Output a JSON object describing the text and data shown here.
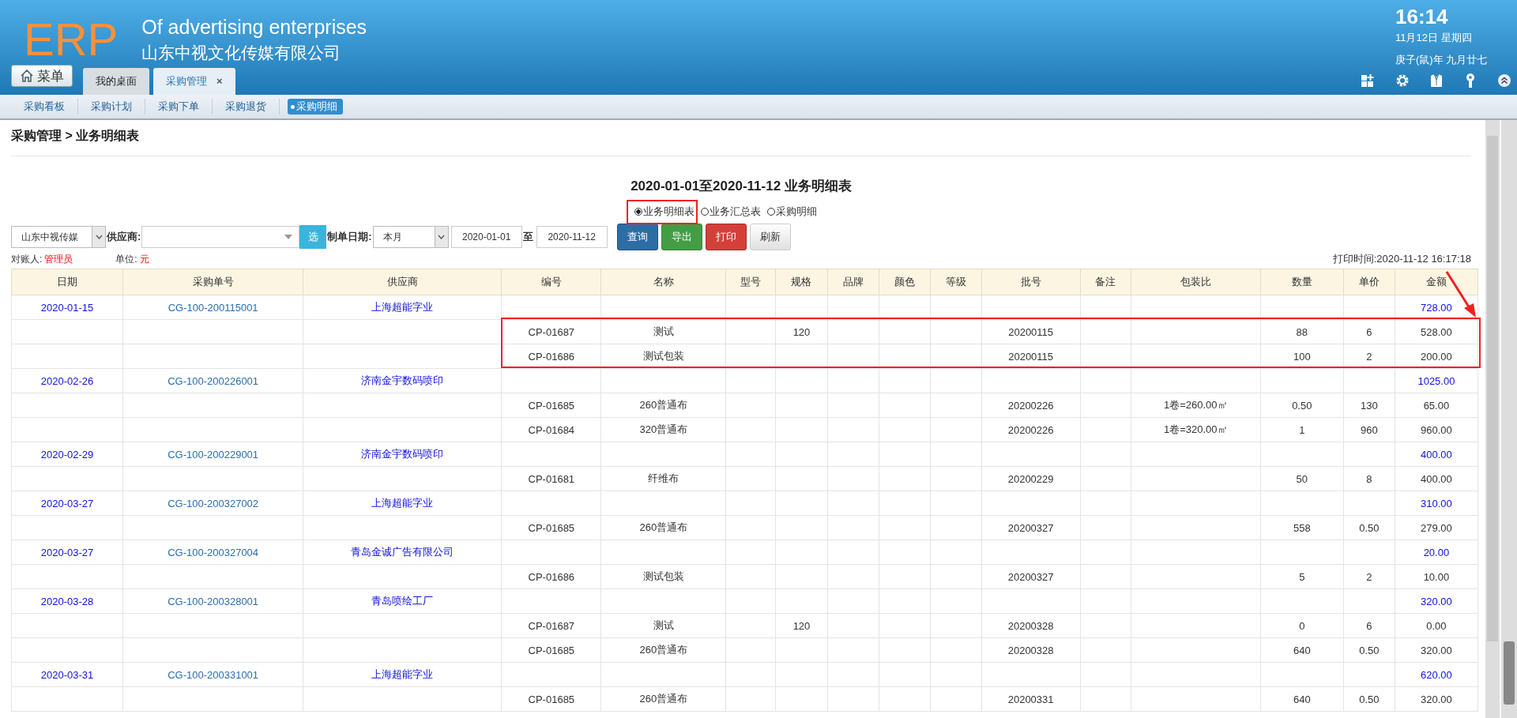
{
  "header": {
    "logo": "ERP",
    "tagline": "Of advertising enterprises",
    "company": "山东中视文化传媒有限公司",
    "time": "16:14",
    "date": "11月12日 星期四",
    "lunar": "庚子(鼠)年 九月廿七"
  },
  "menu_button": {
    "label": "菜单"
  },
  "tabs": [
    {
      "label": "我的桌面",
      "selected": false,
      "closable": false
    },
    {
      "label": "采购管理",
      "selected": true,
      "closable": true,
      "close": "×"
    }
  ],
  "subnav": [
    {
      "label": "采购看板",
      "selected": false
    },
    {
      "label": "采购计划",
      "selected": false
    },
    {
      "label": "采购下单",
      "selected": false
    },
    {
      "label": "采购退货",
      "selected": false
    },
    {
      "label": "采购明细",
      "selected": true
    }
  ],
  "breadcrumb": "采购管理 > 业务明细表",
  "report_title": "2020-01-01至2020-11-12 业务明细表",
  "report_types": [
    {
      "label": "业务明细表",
      "selected": true
    },
    {
      "label": "业务汇总表",
      "selected": false
    },
    {
      "label": "采购明细",
      "selected": false
    }
  ],
  "filters": {
    "company": "山东中视传媒",
    "supplier_label": "供应商:",
    "pick_button": "选",
    "date_label": "制单日期:",
    "period": "本月",
    "date_from": "2020-01-01",
    "to_label": "至",
    "date_to": "2020-11-12"
  },
  "buttons": [
    {
      "label": "查询",
      "kind": "primary"
    },
    {
      "label": "导出",
      "kind": "success"
    },
    {
      "label": "打印",
      "kind": "danger"
    },
    {
      "label": "刷新",
      "kind": "default"
    }
  ],
  "info": {
    "reconciler_label": "对账人:",
    "reconciler": "管理员",
    "unit_label": "单位:",
    "unit": "元",
    "print_time": "打印时间:2020-11-12 16:17:18"
  },
  "table": {
    "columns": [
      "日期",
      "采购单号",
      "供应商",
      "编号",
      "名称",
      "型号",
      "规格",
      "品牌",
      "颜色",
      "等级",
      "批号",
      "备注",
      "包装比",
      "数量",
      "单价",
      "金额"
    ],
    "rows": [
      {
        "kind": "order",
        "date": "2020-01-15",
        "order_no": "CG-100-200115001",
        "supplier": "上海超能字业",
        "amount": "728.00"
      },
      {
        "kind": "item",
        "code": "CP-01687",
        "name": "测试",
        "spec": "120",
        "batch": "20200115",
        "qty": "88",
        "price": "6",
        "amount": "528.00"
      },
      {
        "kind": "item",
        "code": "CP-01686",
        "name": "测试包装",
        "batch": "20200115",
        "qty": "100",
        "price": "2",
        "amount": "200.00"
      },
      {
        "kind": "order",
        "date": "2020-02-26",
        "order_no": "CG-100-200226001",
        "supplier": "济南金宇数码喷印",
        "amount": "1025.00"
      },
      {
        "kind": "item",
        "code": "CP-01685",
        "name": "260普通布",
        "batch": "20200226",
        "pack_ratio": "1卷=260.00㎡",
        "qty": "0.50",
        "price": "130",
        "amount": "65.00"
      },
      {
        "kind": "item",
        "code": "CP-01684",
        "name": "320普通布",
        "batch": "20200226",
        "pack_ratio": "1卷=320.00㎡",
        "qty": "1",
        "price": "960",
        "amount": "960.00"
      },
      {
        "kind": "order",
        "date": "2020-02-29",
        "order_no": "CG-100-200229001",
        "supplier": "济南金宇数码喷印",
        "amount": "400.00"
      },
      {
        "kind": "item",
        "code": "CP-01681",
        "name": "纤维布",
        "batch": "20200229",
        "qty": "50",
        "price": "8",
        "amount": "400.00"
      },
      {
        "kind": "order",
        "date": "2020-03-27",
        "order_no": "CG-100-200327002",
        "supplier": "上海超能字业",
        "amount": "310.00"
      },
      {
        "kind": "item",
        "code": "CP-01685",
        "name": "260普通布",
        "batch": "20200327",
        "qty": "558",
        "price": "0.50",
        "amount": "279.00"
      },
      {
        "kind": "order",
        "date": "2020-03-27",
        "order_no": "CG-100-200327004",
        "supplier": "青岛金诚广告有限公司",
        "amount": "20.00"
      },
      {
        "kind": "item",
        "code": "CP-01686",
        "name": "测试包装",
        "batch": "20200327",
        "qty": "5",
        "price": "2",
        "amount": "10.00"
      },
      {
        "kind": "order",
        "date": "2020-03-28",
        "order_no": "CG-100-200328001",
        "supplier": "青岛喷绘工厂",
        "amount": "320.00"
      },
      {
        "kind": "item",
        "code": "CP-01687",
        "name": "测试",
        "spec": "120",
        "batch": "20200328",
        "qty": "0",
        "price": "6",
        "amount": "0.00"
      },
      {
        "kind": "item",
        "code": "CP-01685",
        "name": "260普通布",
        "batch": "20200328",
        "qty": "640",
        "price": "0.50",
        "amount": "320.00"
      },
      {
        "kind": "order",
        "date": "2020-03-31",
        "order_no": "CG-100-200331001",
        "supplier": "上海超能字业",
        "amount": "620.00"
      },
      {
        "kind": "item",
        "code": "CP-01685",
        "name": "260普通布",
        "batch": "20200331",
        "qty": "640",
        "price": "0.50",
        "amount": "320.00"
      }
    ]
  }
}
